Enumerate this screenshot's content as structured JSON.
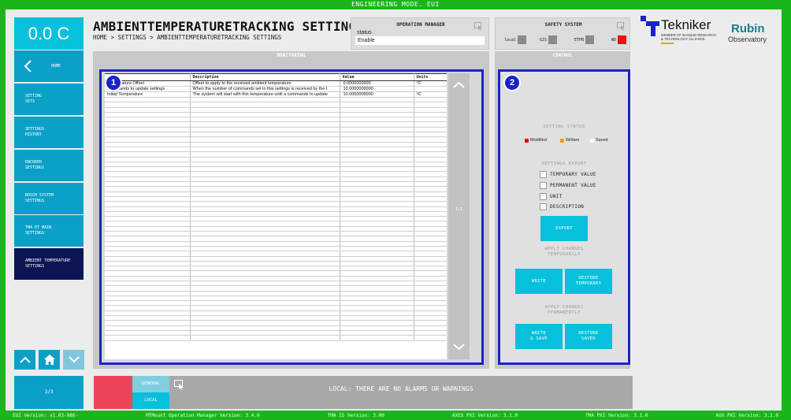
{
  "topbar": "ENGINEERING MODE. EUI",
  "temperature": "0.0 C",
  "nav": {
    "home": "HOME",
    "items": [
      {
        "label": "SETTING\nSETS"
      },
      {
        "label": "SETTINGS\nHISTORY"
      },
      {
        "label": "ENCODER\nSETTINGS"
      },
      {
        "label": "BOSCH SYSTEM\nSETTINGS"
      },
      {
        "label": "TMA ET MAIN\nSETTINGS"
      },
      {
        "label": "AMBIENT TEMPERATURE\nSETTINGS",
        "active": true
      }
    ],
    "page": "3/3"
  },
  "header": {
    "title": "AMBIENTTEMPERATURETRACKING SETTINGS",
    "breadcrumb": "HOME > SETTINGS > AMBIENTTEMPERATURETRACKING SETTINGS"
  },
  "operation_manager": {
    "title": "OPERATION MANAGER",
    "status_label": "status",
    "status_value": "Enable"
  },
  "safety_system": {
    "title": "SAFETY SYSTEM",
    "items": [
      {
        "label": "local",
        "color": "#8a8a8a"
      },
      {
        "label": "GIS",
        "color": "#8a8a8a"
      },
      {
        "label": "ETPB",
        "color": "#8a8a8a"
      },
      {
        "label": "WD",
        "color": "#ee1111"
      }
    ]
  },
  "monitoring": {
    "title": "MONITORING",
    "badge": "1",
    "columns": [
      "Name",
      "Description",
      "Value",
      "Units"
    ],
    "rows": [
      [
        "Temperature Offset",
        "Offset to apply to the received ambient temperature",
        "0.0000000000",
        "°C"
      ],
      [
        "Commands to update settings",
        "When the number of commands set in this settings is received by the t",
        "10.0000000000",
        ""
      ],
      [
        "Initial Temperature",
        "The system will start with this temperature until a commands to update",
        "10.0000000000",
        "°C"
      ]
    ],
    "page_indicator": "1/1"
  },
  "control": {
    "title": "CONTROL",
    "badge": "2",
    "setting_status": "SETTING STATUS",
    "legend": [
      {
        "label": "Modified",
        "color": "#dd1111"
      },
      {
        "label": "Written",
        "color": "#e8a020"
      },
      {
        "label": "Saved",
        "color": "#ffffff"
      }
    ],
    "settings_export": "SETTINGS EXPORT",
    "export_options": [
      "TEMPORARY VALUE",
      "PERMANENT VALUE",
      "UNIT",
      "DESCRIPTION"
    ],
    "export_button": "EXPORT",
    "apply_temp": "APPLY CHANGES\nTEMPORARILY",
    "write": "WRITE",
    "restore_temp": "RESTORE\nTEMPORARY",
    "apply_perm": "APPLY CHANGES\nPERMANENTLY",
    "write_save": "WRITE\n& SAVE",
    "restore_saved": "RESTORE\nSAVED"
  },
  "alarms": {
    "tab_general": "GENERAL",
    "tab_local": "LOCAL",
    "message": "LOCAL: THERE ARE NO ALARMS OR WARNINGS"
  },
  "logos": {
    "tekniker": "Tekniker",
    "tekniker_sub": "MEMBER OF BASQUE RESEARCH\n& TECHNOLOGY ALLIANCE",
    "rubin": "Rubin",
    "rubin_sub": "Observatory"
  },
  "versions": [
    "EUI Version: v1.03-986-",
    "MTMount Operation Manager Version: 3.4.6",
    "TMA IS Version: 3.00",
    "AXES PXI Version: 3.1.0",
    "TMA PXI Version: 3.1.0",
    "AUX PXI Version: 3.1.0"
  ]
}
